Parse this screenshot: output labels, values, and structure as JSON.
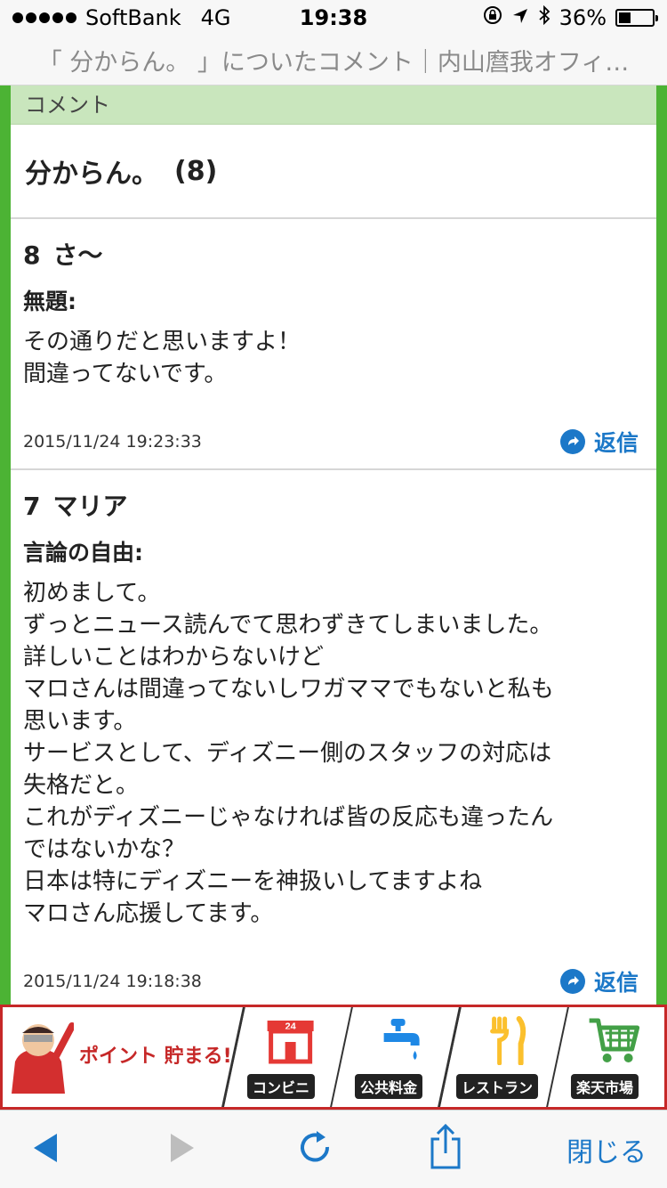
{
  "status_bar": {
    "carrier": "SoftBank",
    "network": "4G",
    "time": "19:38",
    "battery_percent": "36%",
    "battery_level": 0.36,
    "icons": [
      "orientation-lock-icon",
      "location-icon",
      "bluetooth-icon",
      "battery-icon"
    ]
  },
  "page_title": "「 分からん。 」についたコメント｜内山麿我オフィ…",
  "section_header": "コメント",
  "article": {
    "title": "分からん。",
    "count": "(8)"
  },
  "comments": [
    {
      "number": "8",
      "author": "さ〜",
      "subject": "無題:",
      "lines": [
        "その通りだと思いますよ！",
        "間違ってないです。"
      ],
      "date": "2015/11/24 19:23:33",
      "reply_label": "返信"
    },
    {
      "number": "7",
      "author": "マリア",
      "subject": "言論の自由:",
      "lines": [
        "初めまして。",
        "ずっとニュース読んでて思わずきてしまいました。",
        "詳しいことはわからないけど",
        "マロさんは間違ってないしワガママでもないと私も",
        "思います。",
        "サービスとして、ディズニー側のスタッフの対応は",
        "失格だと。",
        "これがディズニーじゃなければ皆の反応も違ったん",
        "ではないかな？",
        "日本は特にディズニーを神扱いしてますよね",
        "マロさん応援してます。"
      ],
      "date": "2015/11/24 19:18:38",
      "reply_label": "返信"
    }
  ],
  "ad": {
    "panels": [
      {
        "label": "ポイント 貯まる!",
        "icon": "mascot-icon"
      },
      {
        "label": "コンビニ",
        "icon": "convenience-store-icon",
        "badge": "24"
      },
      {
        "label": "公共料金",
        "icon": "faucet-icon"
      },
      {
        "label": "レストラン",
        "icon": "fork-knife-icon"
      },
      {
        "label": "楽天市場",
        "icon": "shopping-cart-icon"
      }
    ],
    "colors": {
      "border": "#c62828",
      "convenience": "#e53935",
      "faucet": "#1e88e5",
      "restaurant": "#fbc02d",
      "cart": "#43a047"
    }
  },
  "toolbar": {
    "close_label": "閉じる",
    "icons": [
      "back-arrow-icon",
      "forward-arrow-icon",
      "reload-icon",
      "share-icon"
    ]
  },
  "colors": {
    "accent": "#1c78c8",
    "green_frame": "#4cb334",
    "header_green": "#c9e6bd"
  }
}
